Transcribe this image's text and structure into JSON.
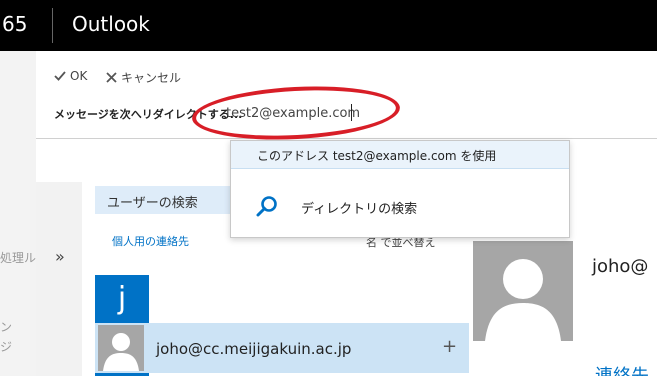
{
  "header": {
    "app_number": "65",
    "app_title": "Outlook"
  },
  "background": {
    "left_items": [
      "処理ル",
      "ン",
      "ジ"
    ]
  },
  "toolbar": {
    "ok_label": "OK",
    "cancel_label": "キャンセル"
  },
  "redirect": {
    "label": "メッセージを次へリダイレクトする...",
    "input_value": "test2@example.com"
  },
  "dropdown": {
    "use_address": "このアドレス test2@example.com を使用",
    "directory_search": "ディレクトリの検索"
  },
  "contacts": {
    "collapse_glyph": "»",
    "search_users": "ユーザーの検索",
    "personal_contacts": "個人用の連絡先",
    "sort_by": "名 で並べ替え",
    "letter": "j",
    "row_email": "joho@cc.meijigakuin.ac.jp",
    "add_glyph": "+"
  },
  "card": {
    "name": "joho@",
    "sub": "連絡先"
  },
  "colors": {
    "accent": "#0072c6",
    "highlight": "#cce3f5",
    "annotation": "#d81e27"
  },
  "icons": [
    "check-icon",
    "close-icon",
    "search-icon",
    "person-icon",
    "chevron-icon",
    "plus-icon"
  ]
}
